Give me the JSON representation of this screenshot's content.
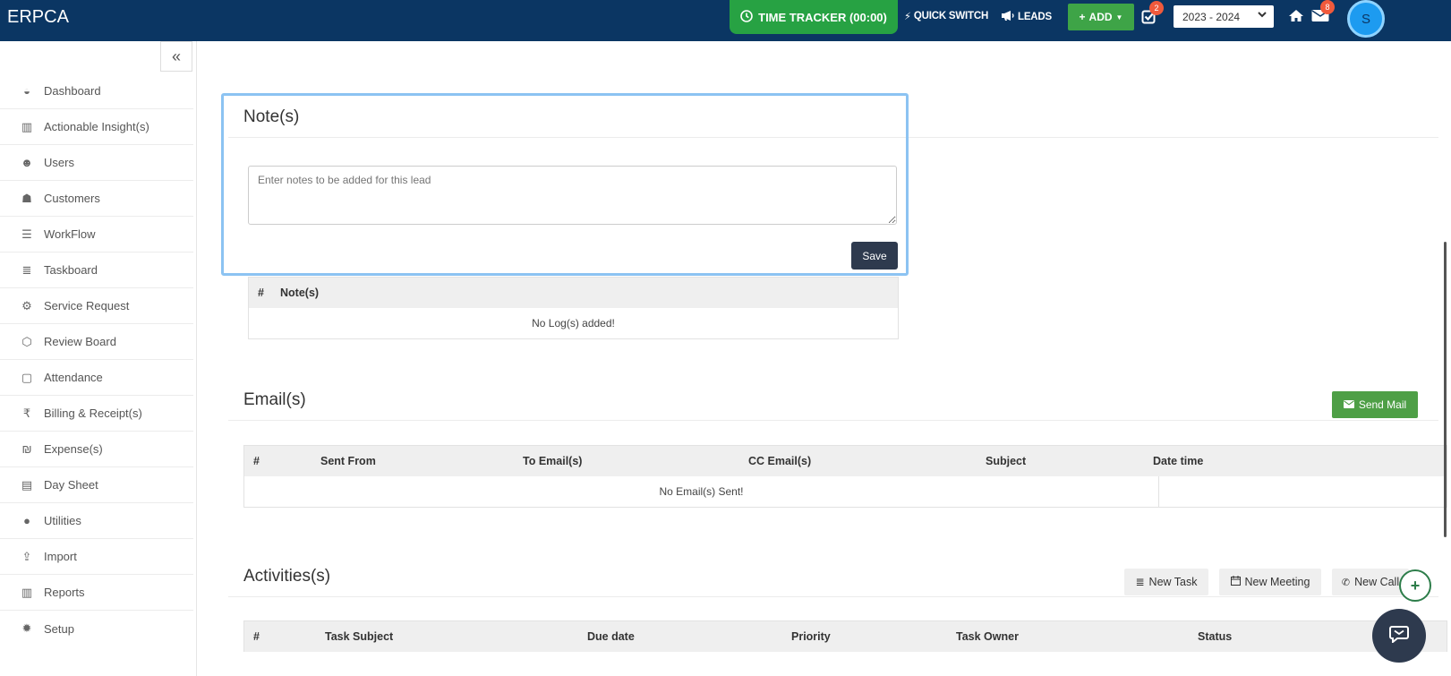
{
  "header": {
    "brand": "ERPCA",
    "time_tracker": "TIME TRACKER (00:00)",
    "quick_switch": "QUICK SWITCH",
    "leads": "LEADS",
    "add_label": "ADD",
    "tasks_badge": "2",
    "year_selected": "2023 - 2024",
    "mail_badge": "8",
    "avatar_initial": "S"
  },
  "sidebar": {
    "collapse_icon": "«",
    "items": [
      {
        "label": "Dashboard",
        "icon": "dashboard-icon"
      },
      {
        "label": "Actionable Insight(s)",
        "icon": "bar-chart-icon"
      },
      {
        "label": "Users",
        "icon": "user-plus-icon"
      },
      {
        "label": "Customers",
        "icon": "users-icon"
      },
      {
        "label": "WorkFlow",
        "icon": "list-icon"
      },
      {
        "label": "Taskboard",
        "icon": "tasks-icon"
      },
      {
        "label": "Service Request",
        "icon": "cogs-icon"
      },
      {
        "label": "Review Board",
        "icon": "review-icon"
      },
      {
        "label": "Attendance",
        "icon": "calendar-icon"
      },
      {
        "label": "Billing & Receipt(s)",
        "icon": "rupee-icon"
      },
      {
        "label": "Expense(s)",
        "icon": "expense-icon"
      },
      {
        "label": "Day Sheet",
        "icon": "sheet-icon"
      },
      {
        "label": "Utilities",
        "icon": "info-icon"
      },
      {
        "label": "Import",
        "icon": "upload-icon"
      },
      {
        "label": "Reports",
        "icon": "report-chart-icon"
      },
      {
        "label": "Setup",
        "icon": "gear-icon"
      }
    ]
  },
  "notes": {
    "title": "Note(s)",
    "placeholder": "Enter notes to be added for this lead",
    "save_label": "Save",
    "columns": [
      "#",
      "Note(s)"
    ],
    "empty": "No Log(s) added!"
  },
  "emails": {
    "title": "Email(s)",
    "send_label": "Send Mail",
    "columns": [
      "#",
      "Sent From",
      "To Email(s)",
      "CC Email(s)",
      "Subject",
      "Date time"
    ],
    "empty": "No Email(s) Sent!"
  },
  "activities": {
    "title": "Activities(s)",
    "new_task": "New Task",
    "new_meeting": "New Meeting",
    "new_call": "New Call",
    "columns": [
      "#",
      "Task Subject",
      "Due date",
      "Priority",
      "Task Owner",
      "Status"
    ]
  },
  "colors": {
    "header_bg": "#0b3663",
    "tracker_green": "#27a243",
    "add_green": "#3ea447",
    "badge_orange": "#f05a3c",
    "focus_blue": "#8cc3f2",
    "dark_button": "#2e3a4e",
    "send_green": "#4e9f46"
  }
}
